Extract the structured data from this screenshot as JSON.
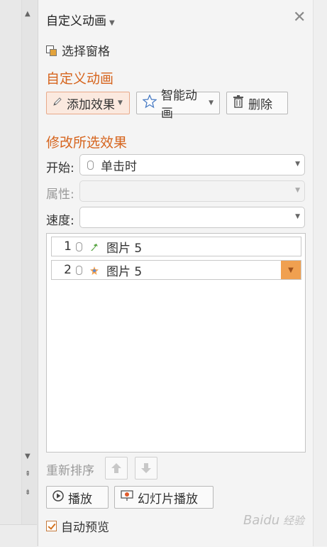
{
  "header": {
    "title": "自定义动画",
    "select_pane": "选择窗格"
  },
  "section_custom_animation": "自定义动画",
  "toolbar": {
    "add_effect": "添加效果",
    "smart_animation": "智能动画",
    "delete": "删除"
  },
  "section_modify": "修改所选效果",
  "fields": {
    "start_label": "开始:",
    "start_value": "单击时",
    "property_label": "属性:",
    "property_value": "",
    "speed_label": "速度:",
    "speed_value": ""
  },
  "animation_list": [
    {
      "index": "1",
      "name": "图片 5",
      "effect": "emphasis"
    },
    {
      "index": "2",
      "name": "图片 5",
      "effect": "entrance",
      "selected": true
    }
  ],
  "reorder_label": "重新排序",
  "buttons": {
    "play": "播放",
    "slideshow": "幻灯片播放"
  },
  "autopreview": {
    "label": "自动预览",
    "checked": true
  },
  "watermark": "Baidu 经验",
  "colors": {
    "accent": "#d6641d",
    "selected_row_dropdown": "#f0a050"
  }
}
